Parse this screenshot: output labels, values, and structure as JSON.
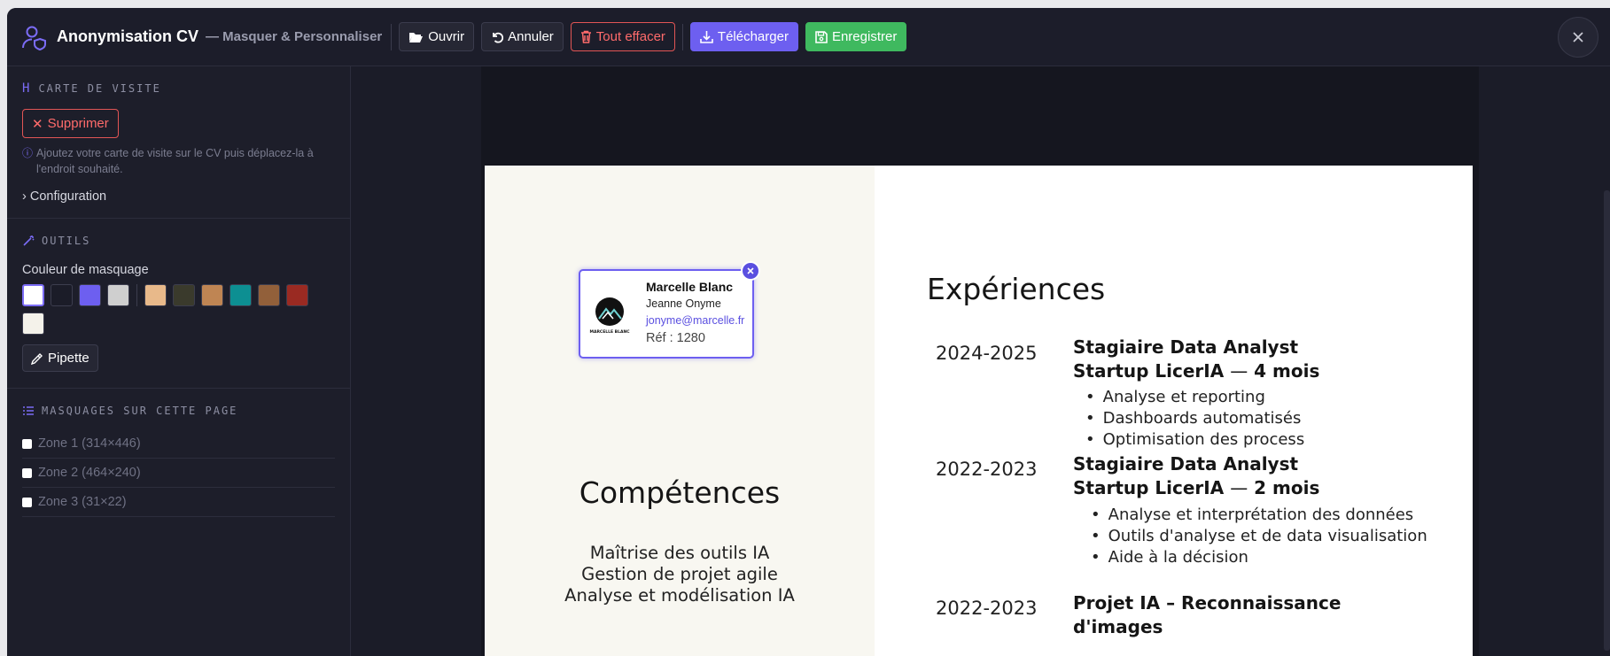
{
  "header": {
    "title": "Anonymisation CV",
    "subtitle": "— Masquer & Personnaliser",
    "buttons": {
      "open": "Ouvrir",
      "undo": "Annuler",
      "clear": "Tout effacer",
      "download": "Télécharger",
      "save": "Enregistrer"
    }
  },
  "sidebar": {
    "card_section": {
      "title": "CARTE DE VISITE",
      "delete_label": "Supprimer",
      "hint": "Ajoutez votre carte de visite sur le CV puis déplacez-la à l'endroit souhaité.",
      "config_label": "Configuration"
    },
    "tools_section": {
      "title": "OUTILS",
      "color_label": "Couleur de masquage",
      "colors_primary": [
        "#ffffff",
        "#1b1c28",
        "#6d5ff0",
        "#cfcfcf"
      ],
      "colors_secondary": [
        "#e8b98a",
        "#3a3a2c",
        "#bf8553",
        "#0d8f92",
        "#92603a",
        "#9a2a22",
        "#f4f2ea"
      ],
      "active_color": "#ffffff",
      "pipette_label": "Pipette"
    },
    "masks_section": {
      "title": "MASQUAGES SUR CETTE PAGE",
      "zones": [
        "Zone 1 (314×446)",
        "Zone 2 (464×240)",
        "Zone 3 (31×22)"
      ]
    }
  },
  "card": {
    "name": "Marcelle Blanc",
    "person": "Jeanne Onyme",
    "email": "jonyme@marcelle.fr",
    "ref": "Réf : 1280",
    "logo_text": "MARCELLE BLANC"
  },
  "cv": {
    "competences_title": "Compétences",
    "skills": [
      "Maîtrise des outils IA",
      "Gestion de projet agile",
      "Analyse et modélisation IA"
    ],
    "experiences_title": "Expériences",
    "experiences": [
      {
        "years": "2024-2025",
        "role": "Stagiaire Data Analyst",
        "company": "Startup LicerIA",
        "dash": "—",
        "duration": "4 mois",
        "bullets": [
          "Analyse et reporting",
          "Dashboards automatisés",
          "Optimisation des process"
        ]
      },
      {
        "years": "2022-2023",
        "role": "Stagiaire Data Analyst",
        "company": "Startup LicerIA",
        "dash": "—",
        "duration": "2 mois",
        "bullets": [
          "Analyse et interprétation des données",
          "Outils d'analyse et de data visualisation",
          "Aide à la décision"
        ]
      },
      {
        "years": "2022-2023",
        "role_line1": "Projet IA – Reconnaissance",
        "role_line2": "d'images"
      }
    ]
  }
}
